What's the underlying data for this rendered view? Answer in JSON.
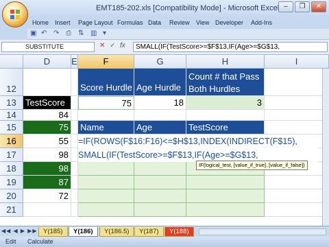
{
  "window": {
    "title": "EMT185-202.xls  [Compatibility Mode]  -  Microsoft Excel",
    "minimize_label": "–",
    "restore_label": "❐",
    "close_label": "✕"
  },
  "ribbon": {
    "tabs": [
      "Home",
      "Insert",
      "Page Layout",
      "Formulas",
      "Data",
      "Review",
      "View",
      "Developer",
      "Add-Ins"
    ]
  },
  "formula_bar": {
    "name_box": "SUBSTITUTE",
    "cancel_icon": "✕",
    "enter_icon": "✓",
    "fx_label": "fx",
    "content": "SMALL(IF(TestScore>=$F$13,IF(Age>=$G$13,"
  },
  "grid": {
    "columns": [
      {
        "label": "D",
        "selected": false
      },
      {
        "label": "E",
        "selected": false
      },
      {
        "label": "F",
        "selected": true
      },
      {
        "label": "G",
        "selected": false
      },
      {
        "label": "H",
        "selected": false
      },
      {
        "label": "I",
        "selected": false
      }
    ],
    "rows": [
      "12",
      "13",
      "14",
      "15",
      "16",
      "17",
      "18",
      "19",
      "20",
      "21"
    ],
    "selected_row": "16",
    "headers": {
      "score_hurdle": "Score Hurdle",
      "age_hurdle": "Age Hurdle",
      "count_line1": "Count # that Pass",
      "count_line2": "Both Hurdles"
    },
    "values": {
      "score_hurdle": "75",
      "age_hurdle": "18",
      "count": "3"
    },
    "results_headers": [
      "Name",
      "Age",
      "TestScore"
    ],
    "testscore_label": "TestScore",
    "testscores": [
      "84",
      "75",
      "55",
      "98",
      "98",
      "87",
      "72"
    ],
    "green_highlight_rows": [
      1,
      3,
      4,
      5
    ]
  },
  "edit_formula": {
    "line1": "=IF(ROWS(F$16:F16)<=$H$13,INDEX(INDIRECT(F$15),",
    "line2": "SMALL(IF(TestScore>=$F$13,IF(Age>=$G$13,"
  },
  "tooltip": {
    "text": "IF(logical_test, [value_if_true], [value_if_false])"
  },
  "sheets": {
    "tabs": [
      "Y(185)",
      "Y(186)",
      "Y(186.5)",
      "Y(187)",
      "Y(188)"
    ],
    "active": "Y(186)"
  },
  "status": {
    "mode": "Edit",
    "calculate": "Calculate"
  },
  "colors": {
    "header_blue": "#1f4e99",
    "dark_green": "#1a6b1a",
    "light_green": "#dbeed1"
  }
}
